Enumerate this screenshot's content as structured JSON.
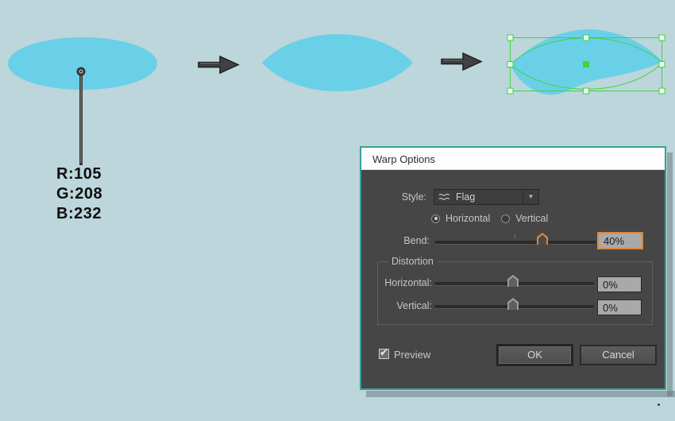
{
  "app": {
    "background_hex": "#BCD6DB"
  },
  "canvas": {
    "shape_fill_hex": "#69D0E8",
    "selection_green_hex": "#3ED43E",
    "steps": [
      "ellipse",
      "lens",
      "flag-warped lens (selected)"
    ],
    "color_annotation": {
      "lines": [
        "R:105",
        "G:208",
        "B:232"
      ]
    }
  },
  "dialog": {
    "title": "Warp Options",
    "border_teal_hex": "#3AA095",
    "body_hex": "#464646",
    "accent_orange_hex": "#D9883F",
    "style": {
      "label": "Style:",
      "value": "Flag"
    },
    "orientation": {
      "options": [
        "Horizontal",
        "Vertical"
      ],
      "selected": "Horizontal"
    },
    "bend": {
      "label": "Bend:",
      "value": "40%",
      "percent": 40
    },
    "distortion": {
      "legend": "Distortion",
      "rows": [
        {
          "label": "Horizontal:",
          "value": "0%",
          "percent": 0
        },
        {
          "label": "Vertical:",
          "value": "0%",
          "percent": 0
        }
      ]
    },
    "preview": {
      "label": "Preview",
      "checked": true
    },
    "buttons": {
      "ok": "OK",
      "cancel": "Cancel"
    }
  },
  "icons": {
    "dropdown_arrow": "▼",
    "check": "✔"
  }
}
